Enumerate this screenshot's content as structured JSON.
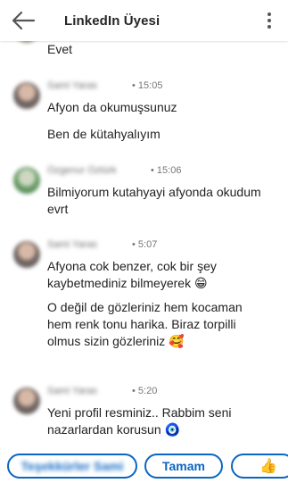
{
  "header": {
    "title": "LinkedIn Üyesi"
  },
  "thread": {
    "previous_message": "Evet",
    "groups": [
      {
        "sender": "Sami Yaras",
        "time": "15:05",
        "messages": [
          "Afyon da okumuşsunuz",
          "Ben de kütahyalıyım"
        ]
      },
      {
        "sender": "Özgenur Öztürk",
        "time": "15:06",
        "messages": [
          "Bilmiyorum kutahyayi afyonda okudum evrt"
        ]
      },
      {
        "sender": "Sami Yaras",
        "time": "5:07",
        "messages": [
          "Afyona cok benzer, cok bir şey kaybetmediniz bilmeyerek 😁",
          "O değil de gözleriniz hem kocaman hem renk tonu harika. Biraz torpilli olmus sizin gözleriniz 🥰"
        ]
      },
      {
        "sender": "Sami Yaras",
        "time": "5:20",
        "messages": [
          "Yeni profil resminiz.. Rabbim seni nazarlardan korusun 🧿"
        ]
      }
    ]
  },
  "quick_replies": {
    "first": "Teşekkürler Sami",
    "second": "Tamam",
    "third": "👍"
  },
  "icons": {
    "back": "back-arrow-icon",
    "menu": "more-vertical-icon"
  },
  "colors": {
    "accent": "#0a66c2"
  }
}
